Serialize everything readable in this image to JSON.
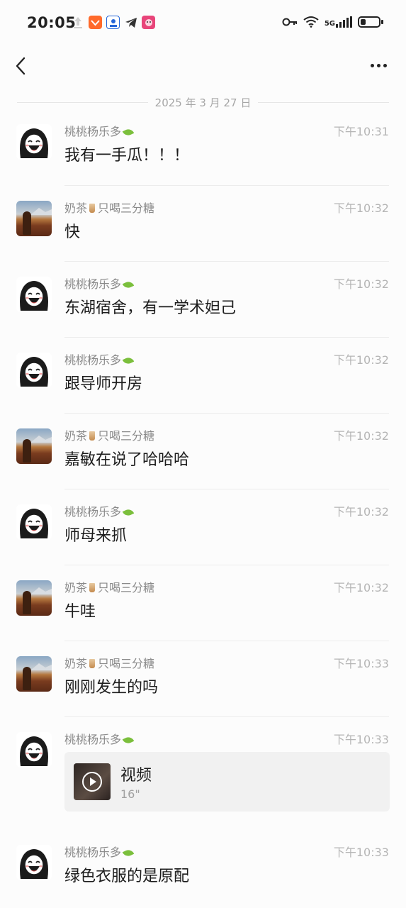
{
  "status": {
    "time": "20:05",
    "network": "5G",
    "battery_level": 0.3
  },
  "nav": {
    "back_icon": "chevron-left-icon",
    "more_icon": "more-dots-icon"
  },
  "date_divider": "2025 年 3 月 27 日",
  "users": {
    "a": {
      "name": "桃桃杨乐多",
      "badge_icon": "leaf-icon"
    },
    "b": {
      "name_prefix": "奶茶",
      "name_suffix": "只喝三分糖",
      "badge_icon": "milk-tea-icon"
    }
  },
  "messages": [
    {
      "sender": "a",
      "time": "下午10:31",
      "text": "我有一手瓜！！！"
    },
    {
      "sender": "b",
      "time": "下午10:32",
      "text": "快"
    },
    {
      "sender": "a",
      "time": "下午10:32",
      "text": "东湖宿舍，有一学术妲己"
    },
    {
      "sender": "a",
      "time": "下午10:32",
      "text": "跟导师开房"
    },
    {
      "sender": "b",
      "time": "下午10:32",
      "text": "嘉敏在说了哈哈哈"
    },
    {
      "sender": "a",
      "time": "下午10:32",
      "text": "师母来抓"
    },
    {
      "sender": "b",
      "time": "下午10:32",
      "text": "牛哇"
    },
    {
      "sender": "b",
      "time": "下午10:33",
      "text": "刚刚发生的吗"
    },
    {
      "sender": "a",
      "time": "下午10:33",
      "type": "video",
      "video_title": "视频",
      "video_duration": "16\""
    },
    {
      "sender": "a",
      "time": "下午10:33",
      "text": "绿色衣服的是原配"
    }
  ]
}
